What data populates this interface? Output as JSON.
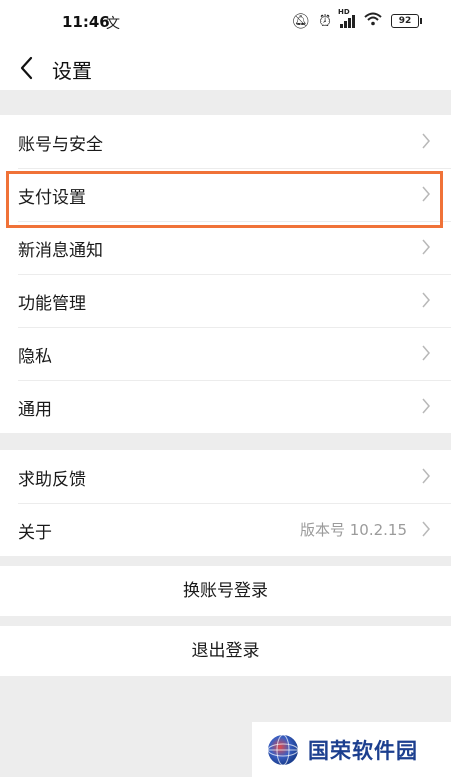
{
  "status_bar": {
    "time": "11:46",
    "left_icon": "notification-icon",
    "battery_level": "92",
    "network_label": "HD",
    "icons": [
      "mute-icon",
      "alarm-icon",
      "signal-icon",
      "wifi-icon",
      "battery-icon"
    ]
  },
  "nav": {
    "title": "设置",
    "back_icon": "chevron-left-icon"
  },
  "settings_group_1": [
    {
      "label": "账号与安全"
    },
    {
      "label": "支付设置"
    },
    {
      "label": "新消息通知"
    },
    {
      "label": "功能管理"
    },
    {
      "label": "隐私"
    },
    {
      "label": "通用"
    }
  ],
  "settings_group_2": [
    {
      "label": "求助反馈"
    },
    {
      "label": "关于",
      "value": "版本号 10.2.15"
    }
  ],
  "actions": {
    "switch_account": "换账号登录",
    "logout": "退出登录"
  },
  "watermark": {
    "text": "国荣软件园"
  },
  "colors": {
    "highlight": "#f07238",
    "background": "#ededed",
    "watermark_text": "#1c3f8f"
  }
}
